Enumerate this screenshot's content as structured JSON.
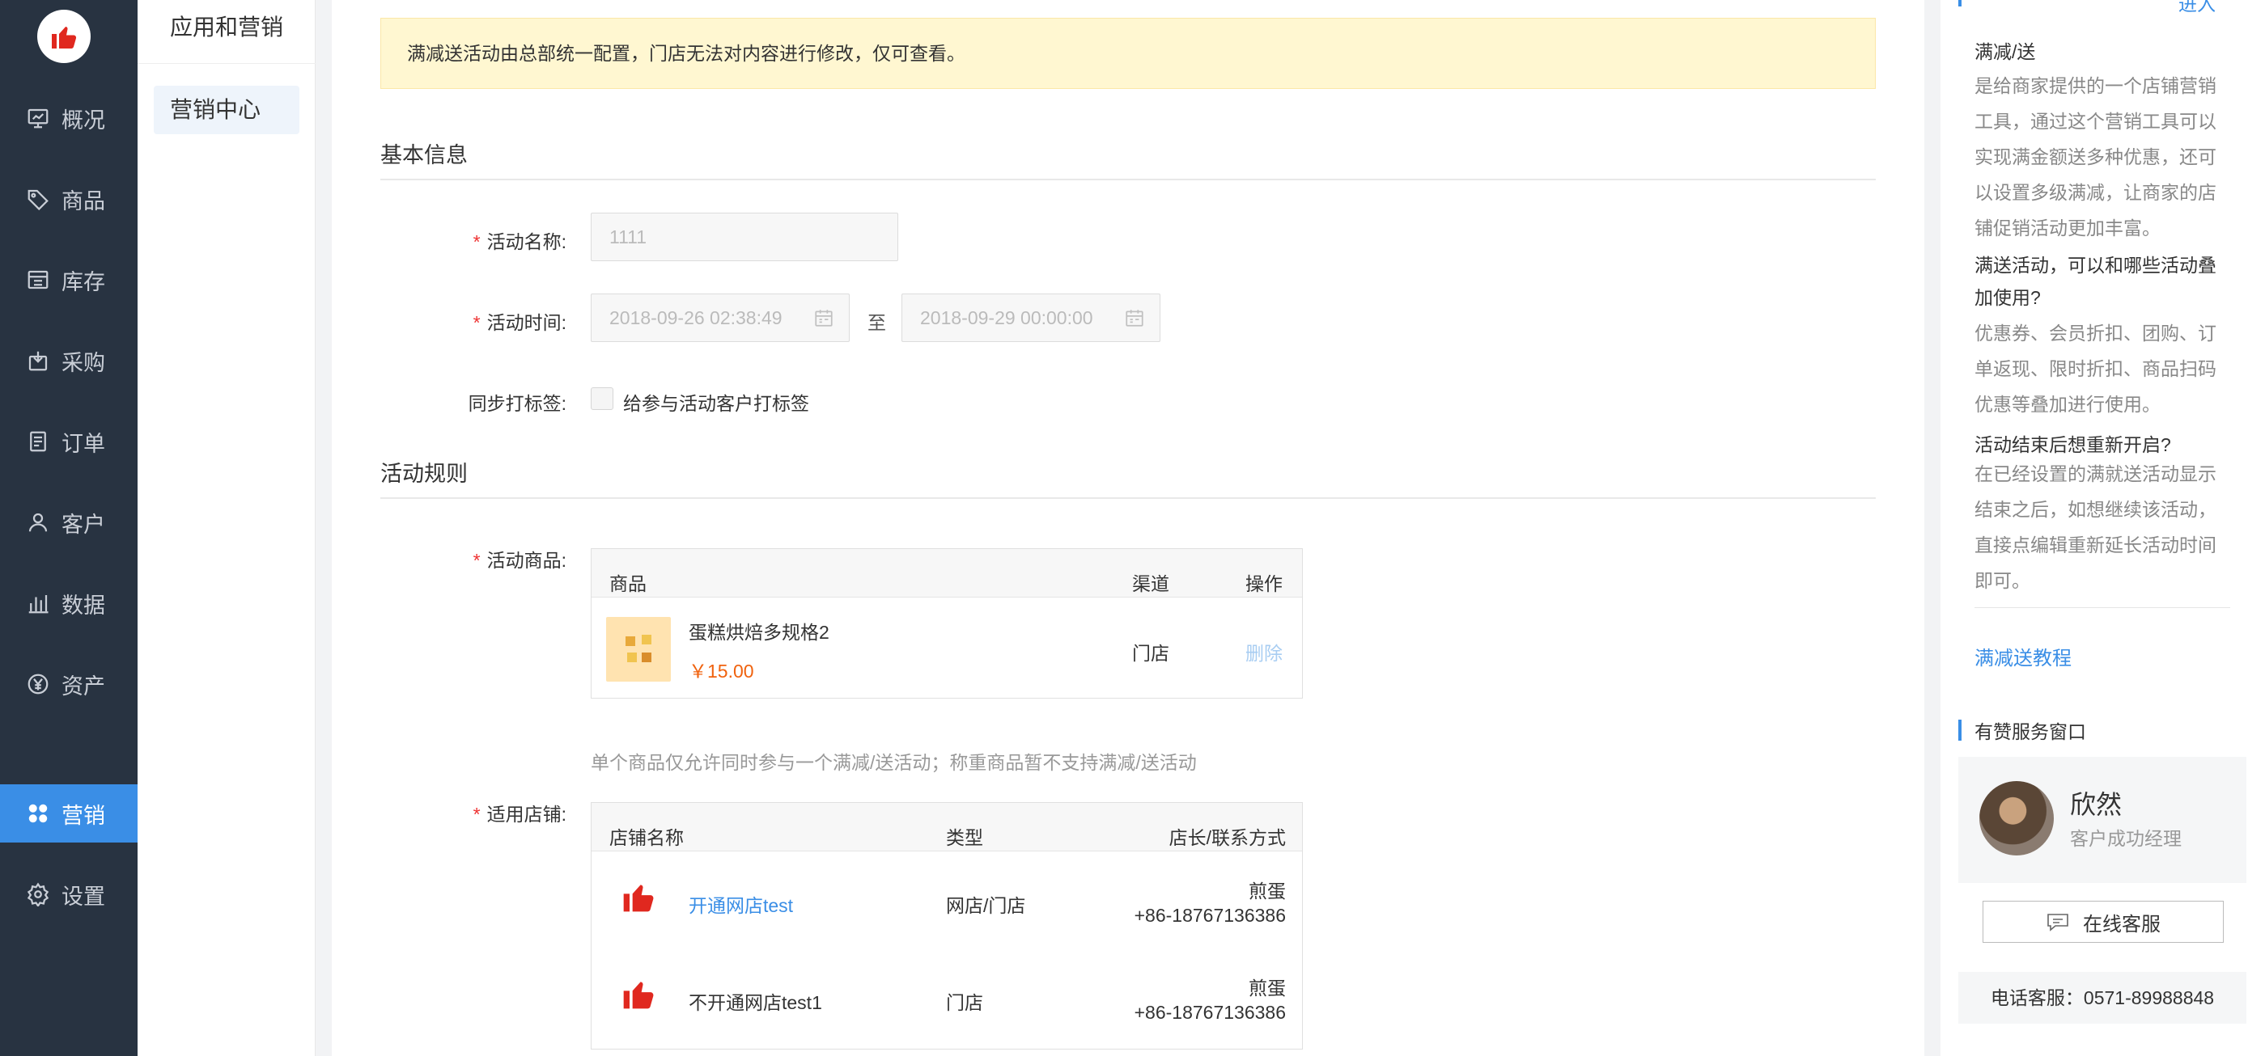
{
  "sidebar": {
    "items": [
      {
        "label": "概况",
        "icon": "dashboard-icon"
      },
      {
        "label": "商品",
        "icon": "tag-icon"
      },
      {
        "label": "库存",
        "icon": "warehouse-icon"
      },
      {
        "label": "采购",
        "icon": "purchase-icon"
      },
      {
        "label": "订单",
        "icon": "order-icon"
      },
      {
        "label": "客户",
        "icon": "user-icon"
      },
      {
        "label": "数据",
        "icon": "chart-icon"
      },
      {
        "label": "资产",
        "icon": "yen-icon"
      },
      {
        "label": "营销",
        "icon": "apps-icon",
        "active": true
      },
      {
        "label": "设置",
        "icon": "gear-icon"
      }
    ]
  },
  "subsidebar": {
    "group_title": "应用和营销",
    "active_item": "营销中心"
  },
  "main": {
    "notice": "满减送活动由总部统一配置，门店无法对内容进行修改，仅可查看。",
    "basic_section": "基本信息",
    "name_label": "活动名称:",
    "name_value": "1111",
    "time_label": "活动时间:",
    "start_time": "2018-09-26 02:38:49",
    "to": "至",
    "end_time": "2018-09-29 00:00:00",
    "tag_label": "同步打标签:",
    "tag_checkbox": "给参与活动客户打标签",
    "rules_section": "活动规则",
    "goods_label": "活动商品:",
    "goods_table": {
      "headers": [
        "商品",
        "渠道",
        "操作"
      ],
      "rows": [
        {
          "name": "蛋糕烘焙多规格2",
          "price": "￥15.00",
          "channel": "门店",
          "action": "删除"
        }
      ]
    },
    "goods_hint": "单个商品仅允许同时参与一个满减/送活动；称重商品暂不支持满减/送活动",
    "stores_label": "适用店铺:",
    "stores_table": {
      "headers": [
        "店铺名称",
        "类型",
        "店长/联系方式"
      ],
      "rows": [
        {
          "name": "开通网店test",
          "type": "网店/门店",
          "manager": "煎蛋",
          "phone": "+86-18767136386"
        },
        {
          "name": "不开通网店test1",
          "type": "门店",
          "manager": "煎蛋",
          "phone": "+86-18767136386"
        }
      ]
    }
  },
  "help": {
    "top_more": "进入",
    "q1_title": "满减/送",
    "q1_body": "是给商家提供的一个店铺营销工具，通过这个营销工具可以实现满金额送多种优惠，还可以设置多级满减，让商家的店铺促销活动更加丰富。",
    "q2_title": "满送活动，可以和哪些活动叠加使用?",
    "q2_body": "优惠券、会员折扣、团购、订单返现、限时折扣、商品扫码优惠等叠加进行使用。",
    "q3_title": "活动结束后想重新开启?",
    "q3_body": "在已经设置的满就送活动显示结束之后，如想继续该活动，直接点编辑重新延长活动时间即可。",
    "tutorial_link": "满减送教程",
    "service_title": "有赞服务窗口",
    "service_name": "欣然",
    "service_role": "客户成功经理",
    "online_btn": "在线客服",
    "phone": "电话客服：0571-89988848"
  },
  "colors": {
    "sidebar_bg": "#283341",
    "accent": "#3a8ee6",
    "brand_red": "#e0281f",
    "notice_bg": "#fff7d1",
    "price": "#f0620e"
  }
}
